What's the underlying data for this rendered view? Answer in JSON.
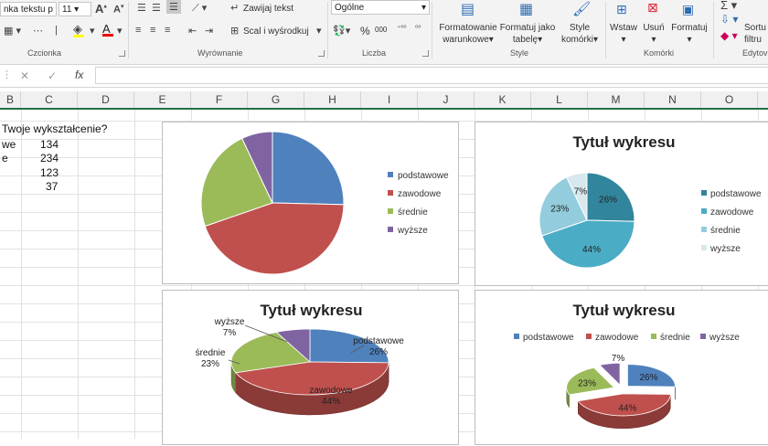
{
  "ribbon": {
    "font_name": "nka tekstu p",
    "font_size": "11",
    "wrap_text": "Zawijaj tekst",
    "merge_center": "Scal i wyśrodkuj",
    "number_format": "Ogólne",
    "percent": "%",
    "thousands": "000",
    "cond_format": [
      "Formatowanie",
      "warunkowe"
    ],
    "format_table": [
      "Formatuj jako",
      "tabelę"
    ],
    "cell_styles": [
      "Style",
      "komórki"
    ],
    "insert": "Wstaw",
    "delete": "Usuń",
    "format": "Formatuj",
    "sort_filter": [
      "Sortu",
      "filtru"
    ],
    "groups": {
      "font": "Czcionka",
      "alignment": "Wyrównanie",
      "number": "Liczba",
      "styles": "Style",
      "cells": "Komórki",
      "editing": "Edytov"
    }
  },
  "formula_bar": {
    "fx": "fx",
    "cancel": "✕",
    "enter": "✓"
  },
  "columns": [
    "B",
    "C",
    "D",
    "E",
    "F",
    "G",
    "H",
    "I",
    "J",
    "K",
    "L",
    "M",
    "N",
    "O"
  ],
  "cells": {
    "question": "Twoje wykształcenie?",
    "rows": [
      {
        "label": "we",
        "value": "134"
      },
      {
        "label": "e",
        "value": "234"
      },
      {
        "label": "",
        "value": "123"
      },
      {
        "label": "",
        "value": "37"
      }
    ]
  },
  "colors": {
    "excel_green": "#217346",
    "chart1": [
      "#4f81bd",
      "#c0504d",
      "#9bbb59",
      "#8064a2"
    ],
    "chart2": [
      "#31859c",
      "#4bacc6",
      "#93cddd",
      "#d7e8ee"
    ]
  },
  "chart_data": [
    {
      "type": "pie",
      "title": "",
      "categories": [
        "podstawowe",
        "zawodowe",
        "średnie",
        "wyższe"
      ],
      "values": [
        134,
        234,
        123,
        37
      ],
      "legend": "right",
      "data_labels": false
    },
    {
      "type": "pie",
      "title": "Tytuł wykresu",
      "categories": [
        "podstawowe",
        "zawodowe",
        "średnie",
        "wyższe"
      ],
      "values": [
        134,
        234,
        123,
        37
      ],
      "data_labels": [
        "26%",
        "44%",
        "23%",
        "7%"
      ],
      "legend": "right"
    },
    {
      "type": "pie",
      "style": "3d",
      "title": "Tytuł wykresu",
      "categories": [
        "podstawowe",
        "zawodowe",
        "średnie",
        "wyższe"
      ],
      "values": [
        134,
        234,
        123,
        37
      ],
      "data_labels": [
        "26%",
        "44%",
        "23%",
        "7%"
      ],
      "legend": "none"
    },
    {
      "type": "pie",
      "style": "3d-exploded",
      "title": "Tytuł wykresu",
      "categories": [
        "podstawowe",
        "zawodowe",
        "średnie",
        "wyższe"
      ],
      "values": [
        134,
        234,
        123,
        37
      ],
      "data_labels": [
        "26%",
        "44%",
        "23%",
        "7%"
      ],
      "legend": "top"
    }
  ]
}
